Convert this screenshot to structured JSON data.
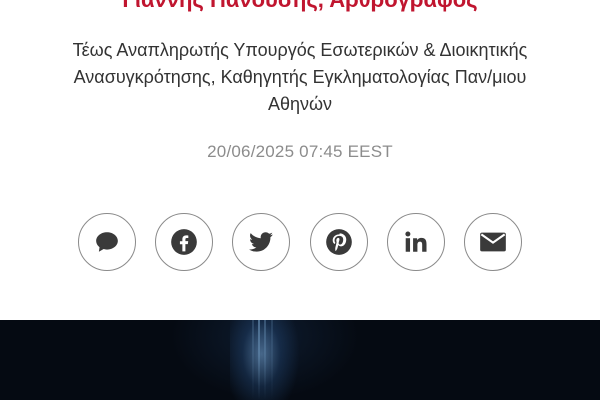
{
  "author": {
    "name": "Γιάννης Πανούσης, Αρθρογράφος",
    "bio": "Τέως Αναπληρωτής Υπουργός Εσωτερικών & Διοικητικής Ανασυγκρότησης, Καθηγητής Εγκληματολογίας Παν/μιου Αθηνών",
    "accent_color": "#c0152f"
  },
  "article": {
    "timestamp": "20/06/2025 07:45 EEST"
  },
  "share": {
    "buttons": [
      {
        "icon": "comment-icon"
      },
      {
        "icon": "facebook-icon"
      },
      {
        "icon": "twitter-icon"
      },
      {
        "icon": "pinterest-icon"
      },
      {
        "icon": "linkedin-icon"
      },
      {
        "icon": "email-icon"
      }
    ]
  },
  "colors": {
    "icon": "#3a3a3a",
    "border": "#8a8a8a",
    "hero_bg": "#050a12"
  }
}
